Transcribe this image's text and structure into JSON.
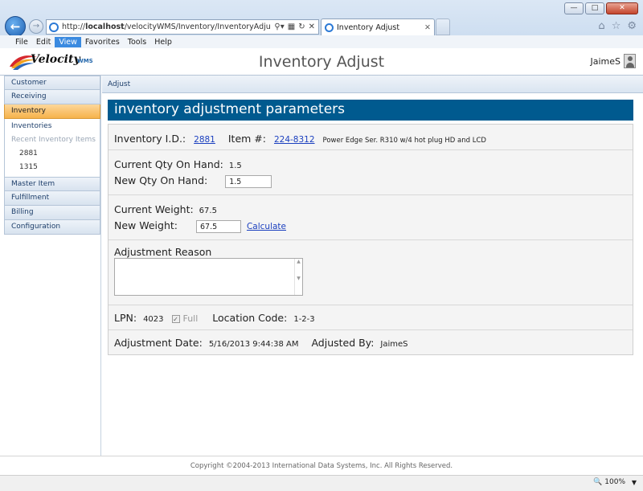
{
  "browser": {
    "url_prefix": "http://",
    "url_host": "localhost",
    "url_path": "/velocityWMS/Inventory/InventoryAdjust.aspx?INVEN",
    "tab_title": "Inventory Adjust",
    "menu": [
      "File",
      "Edit",
      "View",
      "Favorites",
      "Tools",
      "Help"
    ],
    "active_menu": "View"
  },
  "header": {
    "logo_text": "Velocity",
    "logo_sub": "WMS",
    "title": "Inventory Adjust",
    "user": "JaimeS"
  },
  "sidebar": {
    "items": [
      {
        "label": "Customer"
      },
      {
        "label": "Receiving"
      },
      {
        "label": "Inventory",
        "selected": true
      }
    ],
    "inventory_sub": {
      "inventories": "Inventories",
      "recent_label": "Recent Inventory Items",
      "recent": [
        "2881",
        "1315"
      ]
    },
    "items_after": [
      {
        "label": "Master Item"
      },
      {
        "label": "Fulfillment"
      },
      {
        "label": "Billing"
      },
      {
        "label": "Configuration"
      }
    ]
  },
  "breadcrumb": "Adjust",
  "section_title": "inventory adjustment parameters",
  "form": {
    "inventory_id_label": "Inventory I.D.:",
    "inventory_id": "2881",
    "item_label": "Item #:",
    "item_number": "224-8312",
    "item_description": "Power Edge Ser. R310 w/4 hot plug HD and LCD",
    "current_qty_label": "Current Qty On Hand:",
    "current_qty": "1.5",
    "new_qty_label": "New Qty On Hand:",
    "new_qty": "1.5",
    "current_weight_label": "Current Weight:",
    "current_weight": "67.5",
    "new_weight_label": "New Weight:",
    "new_weight": "67.5",
    "calculate_label": "Calculate",
    "reason_label": "Adjustment Reason",
    "reason_value": "",
    "lpn_label": "LPN:",
    "lpn": "4023",
    "full_label": "Full",
    "location_label": "Location Code:",
    "location": "1-2-3",
    "adj_date_label": "Adjustment Date:",
    "adj_date": "5/16/2013 9:44:38 AM",
    "adj_by_label": "Adjusted By:",
    "adj_by": "JaimeS"
  },
  "footer": {
    "copyright": "Copyright ©2004-2013 International Data Systems, Inc. All Rights Reserved."
  },
  "status": {
    "zoom": "100%"
  },
  "icons": [
    "back-icon",
    "forward-icon",
    "ie-icon",
    "search-icon",
    "refresh-icon",
    "stop-icon",
    "home-icon",
    "star-icon",
    "gear-icon",
    "user-icon",
    "zoom-icon"
  ],
  "colors": {
    "section_bar": "#005a8f",
    "selected_nav": "#f6b24b",
    "link": "#1a3fbf"
  }
}
